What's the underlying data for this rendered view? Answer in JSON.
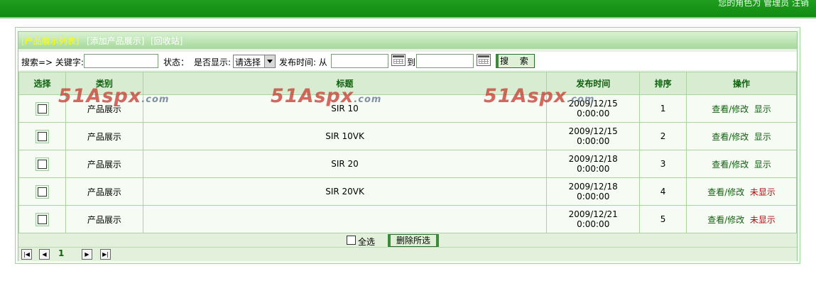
{
  "header": {
    "user_info": "您的角色为 管理员   注销"
  },
  "tabs": [
    {
      "label": "[产品展示列表]"
    },
    {
      "label": "[添加产品展示]"
    },
    {
      "label": "[回收站]"
    }
  ],
  "search": {
    "prefix": "搜索=> 关键字:",
    "status_label": "状态：",
    "display_label": "是否显示:",
    "display_select": "请选择",
    "time_label": "发布时间: 从",
    "to_label": "到",
    "button": "搜 索"
  },
  "table": {
    "headers": [
      "选择",
      "类别",
      "标题",
      "发布时间",
      "排序",
      "操作"
    ],
    "rows": [
      {
        "category": "产品展示",
        "title": "SIR 10",
        "date": "2009/12/15",
        "time": "0:00:00",
        "order": "1",
        "edit": "查看/修改",
        "status": "显示",
        "status_color": "#0f5f0f"
      },
      {
        "category": "产品展示",
        "title": "SIR 10VK",
        "date": "2009/12/15",
        "time": "0:00:00",
        "order": "2",
        "edit": "查看/修改",
        "status": "显示",
        "status_color": "#0f5f0f"
      },
      {
        "category": "产品展示",
        "title": "SIR 20",
        "date": "2009/12/18",
        "time": "0:00:00",
        "order": "3",
        "edit": "查看/修改",
        "status": "显示",
        "status_color": "#0f5f0f"
      },
      {
        "category": "产品展示",
        "title": "SIR 20VK",
        "date": "2009/12/18",
        "time": "0:00:00",
        "order": "4",
        "edit": "查看/修改",
        "status": "未显示",
        "status_color": "#b01010"
      },
      {
        "category": "产品展示",
        "title": "",
        "date": "2009/12/21",
        "time": "0:00:00",
        "order": "5",
        "edit": "查看/修改",
        "status": "未显示",
        "status_color": "#b01010"
      }
    ]
  },
  "footer": {
    "select_all": "全选",
    "delete_button": "删除所选",
    "current_page": "1"
  },
  "watermark": {
    "text": "51Aspx",
    "suffix": ".com"
  },
  "colors": {
    "topbar": "#118a11",
    "active_tab": "#ffff00",
    "header_text": "#106010"
  }
}
